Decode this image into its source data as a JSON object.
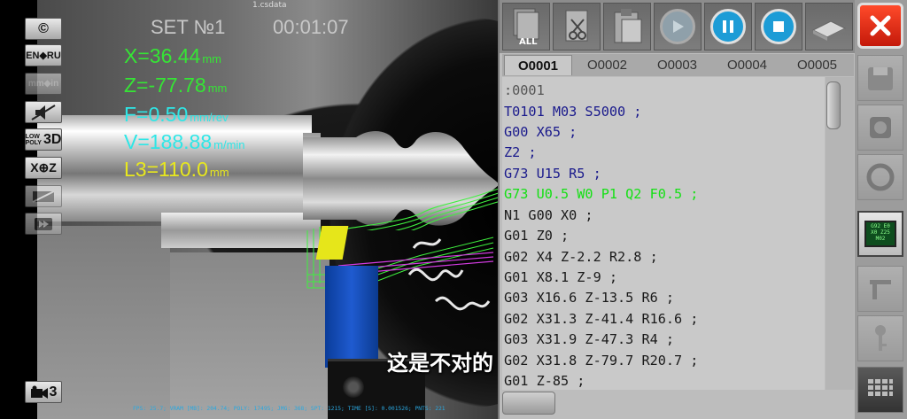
{
  "header": {
    "file_name": "1.csdata",
    "set_label": "SET №1",
    "timer": "00:01:07"
  },
  "toolbar": {
    "buttons": [
      {
        "name": "copyright",
        "label": "©"
      },
      {
        "name": "language",
        "label": "EN◆RU"
      },
      {
        "name": "units",
        "label": "mm◆in"
      },
      {
        "name": "sound",
        "label": ""
      },
      {
        "name": "graphics-quality",
        "label_top": "LOW",
        "label_mid": "POLY",
        "label_big": "3D"
      },
      {
        "name": "coordinates",
        "label": "X⊕Z"
      },
      {
        "name": "display-mode",
        "label": ""
      },
      {
        "name": "replay",
        "label": ""
      }
    ],
    "camera": {
      "label": "3"
    }
  },
  "readouts": {
    "x": {
      "value": "X=36.44",
      "unit": "mm"
    },
    "z": {
      "value": "Z=-77.78",
      "unit": "mm"
    },
    "f": {
      "value": "F=0.50",
      "unit": "mm/rev"
    },
    "v": {
      "value": "V=188.88",
      "unit": "m/min"
    },
    "l3": {
      "value": "L3=110.0",
      "unit": "mm"
    }
  },
  "stats_line": "FPS: 25.7; VRAM [MB]: 204.74; POLY: 17495; JMG: 368; SPT: 1215; TIME [S]: 0.001526; PNTS: 221",
  "subtitle": "这是不对的",
  "program": {
    "tabs": [
      {
        "label": "O0001",
        "active": true
      },
      {
        "label": "O0002",
        "active": false
      },
      {
        "label": "O0003",
        "active": false
      },
      {
        "label": "O0004",
        "active": false
      },
      {
        "label": "O0005",
        "active": false
      }
    ],
    "lines": [
      {
        "text": ":0001",
        "style": "dim"
      },
      {
        "text": "T0101 M03 S5000 ;",
        "style": "code"
      },
      {
        "text": "G00 X65 ;",
        "style": "code"
      },
      {
        "text": "Z2 ;",
        "style": "code"
      },
      {
        "text": "G73 U15 R5 ;",
        "style": "code"
      },
      {
        "text": "G73 U0.5 W0 P1 Q2 F0.5 ;",
        "style": "hl"
      },
      {
        "text": "N1 G00 X0 ;",
        "style": "plain"
      },
      {
        "text": "G01 Z0 ;",
        "style": "plain"
      },
      {
        "text": "G02 X4 Z-2.2 R2.8 ;",
        "style": "plain"
      },
      {
        "text": "G01 X8.1 Z-9 ;",
        "style": "plain"
      },
      {
        "text": "G03 X16.6 Z-13.5 R6 ;",
        "style": "plain"
      },
      {
        "text": "G02 X31.3 Z-41.4 R16.6 ;",
        "style": "plain"
      },
      {
        "text": "G03 X31.9 Z-47.3 R4 ;",
        "style": "plain"
      },
      {
        "text": "G02 X31.8 Z-79.7 R20.7 ;",
        "style": "plain"
      },
      {
        "text": "G01 Z-85 ;",
        "style": "plain"
      }
    ]
  },
  "top_buttons": [
    {
      "name": "select-all",
      "label": "ALL"
    },
    {
      "name": "cut",
      "label": ""
    },
    {
      "name": "paste",
      "label": ""
    },
    {
      "name": "play",
      "label": ""
    },
    {
      "name": "pause",
      "label": ""
    },
    {
      "name": "stop",
      "label": ""
    },
    {
      "name": "manual",
      "label": ""
    }
  ],
  "right_buttons": [
    {
      "name": "disk",
      "label": ""
    },
    {
      "name": "chuck",
      "label": ""
    },
    {
      "name": "tool-ring",
      "label": ""
    },
    {
      "name": "program-monitor",
      "label": "G92 E0 X0 Z25 M02"
    },
    {
      "name": "caliper",
      "label": ""
    },
    {
      "name": "key",
      "label": ""
    },
    {
      "name": "keypad",
      "label": ""
    }
  ],
  "colors": {
    "x_z_readouts": "#35e535",
    "f_v_readouts": "#2ee6e6",
    "l3_readout": "#e8e81e",
    "active_line": "#14e014",
    "code_text": "#1a1a8c",
    "close_button": "#e0301a"
  }
}
